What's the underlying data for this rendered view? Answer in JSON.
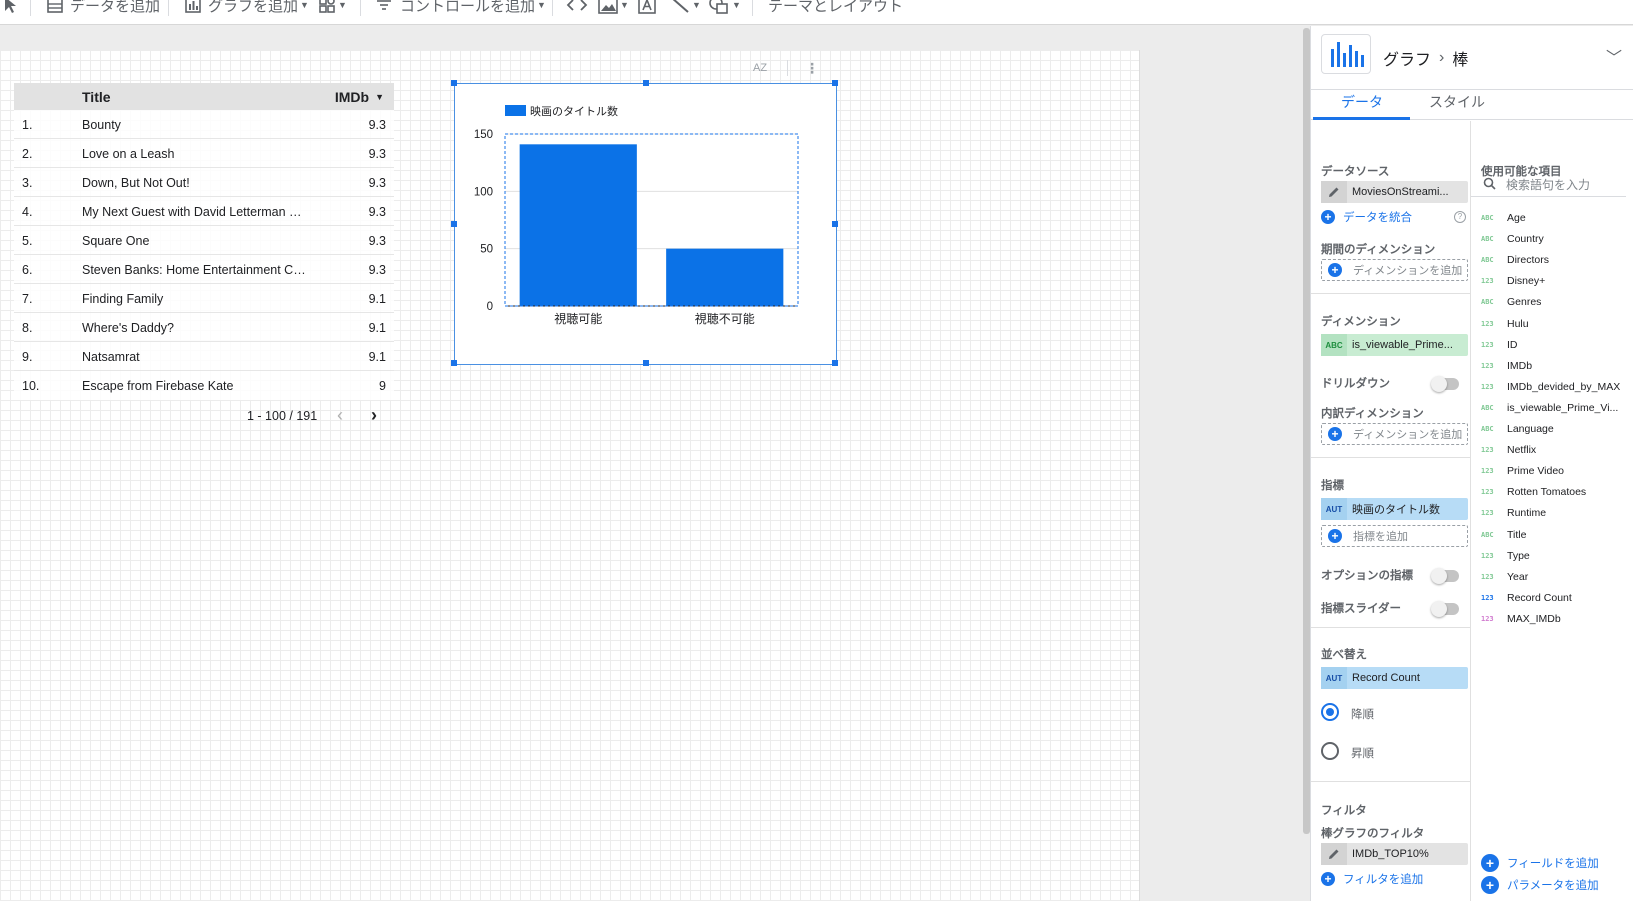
{
  "toolbar": {
    "add_data": "データを追加",
    "add_chart": "グラフを追加",
    "add_control": "コントロールを追加",
    "theme_layout": "テーマとレイアウト"
  },
  "table": {
    "headers": {
      "title": "Title",
      "imdb": "IMDb"
    },
    "rows": [
      {
        "rank": "1.",
        "title": "Bounty",
        "imdb": "9.3"
      },
      {
        "rank": "2.",
        "title": "Love on a Leash",
        "imdb": "9.3"
      },
      {
        "rank": "3.",
        "title": "Down, But Not Out!",
        "imdb": "9.3"
      },
      {
        "rank": "4.",
        "title": "My Next Guest with David Letterman an...",
        "imdb": "9.3"
      },
      {
        "rank": "5.",
        "title": "Square One",
        "imdb": "9.3"
      },
      {
        "rank": "6.",
        "title": "Steven Banks: Home Entertainment Cent...",
        "imdb": "9.3"
      },
      {
        "rank": "7.",
        "title": "Finding Family",
        "imdb": "9.1"
      },
      {
        "rank": "8.",
        "title": "Where's Daddy?",
        "imdb": "9.1"
      },
      {
        "rank": "9.",
        "title": "Natsamrat",
        "imdb": "9.1"
      },
      {
        "rank": "10.",
        "title": "Escape from Firebase Kate",
        "imdb": "9"
      }
    ],
    "pagination": "1 - 100 / 191"
  },
  "chart_toolbar": {
    "sort_label": "AZ"
  },
  "chart_data": {
    "type": "bar",
    "categories": [
      "視聴可能",
      "視聴不可能"
    ],
    "series": [
      {
        "name": "映画のタイトル数",
        "values": [
          141,
          50
        ],
        "color": "#0b72e7"
      }
    ],
    "ylim": [
      0,
      150
    ],
    "yticks": [
      0,
      50,
      100,
      150
    ],
    "legend": "top-left",
    "grid": true
  },
  "panel": {
    "breadcrumb": {
      "root": "グラフ",
      "current": "棒"
    },
    "tabs": [
      "データ",
      "スタイル"
    ],
    "data_source_label": "データソース",
    "data_source": "MoviesOnStreami...",
    "blend_data": "データを統合",
    "date_dim_label": "期間のディメンション",
    "add_dimension": "ディメンションを追加",
    "dimension_label": "ディメンション",
    "dimension": "is_viewable_Prime...",
    "drilldown_label": "ドリルダウン",
    "breakdown_label": "内訳ディメンション",
    "metric_label": "指標",
    "metric": "映画のタイトル数",
    "add_metric": "指標を追加",
    "optional_metric_label": "オプションの指標",
    "metric_slider_label": "指標スライダー",
    "sort_label": "並べ替え",
    "sort_field": "Record Count",
    "sort_desc": "降順",
    "sort_asc": "昇順",
    "filter_label": "フィルタ",
    "bar_filter_label": "棒グラフのフィルタ",
    "filter_value": "IMDb_TOP10%",
    "add_filter": "フィルタを追加",
    "available_fields_label": "使用可能な項目",
    "search_placeholder": "検索語句を入力",
    "add_field": "フィールドを追加",
    "add_parameter": "パラメータを追加",
    "tag_abc": "ABC",
    "tag_aut": "AUT",
    "fields": [
      {
        "type": "ABC",
        "name": "Age"
      },
      {
        "type": "ABC",
        "name": "Country"
      },
      {
        "type": "ABC",
        "name": "Directors"
      },
      {
        "type": "123",
        "name": "Disney+"
      },
      {
        "type": "ABC",
        "name": "Genres"
      },
      {
        "type": "123",
        "name": "Hulu"
      },
      {
        "type": "123",
        "name": "ID"
      },
      {
        "type": "123",
        "name": "IMDb"
      },
      {
        "type": "123",
        "name": "IMDb_devided_by_MAX"
      },
      {
        "type": "ABC",
        "name": "is_viewable_Prime_Vi..."
      },
      {
        "type": "ABC",
        "name": "Language"
      },
      {
        "type": "123",
        "name": "Netflix"
      },
      {
        "type": "123",
        "name": "Prime Video"
      },
      {
        "type": "123",
        "name": "Rotten Tomatoes"
      },
      {
        "type": "123",
        "name": "Runtime"
      },
      {
        "type": "ABC",
        "name": "Title"
      },
      {
        "type": "123",
        "name": "Type"
      },
      {
        "type": "123",
        "name": "Year"
      },
      {
        "type": "123",
        "name": "Record Count",
        "kind": "calc"
      },
      {
        "type": "123",
        "name": "MAX_IMDb",
        "kind": "param"
      }
    ]
  }
}
